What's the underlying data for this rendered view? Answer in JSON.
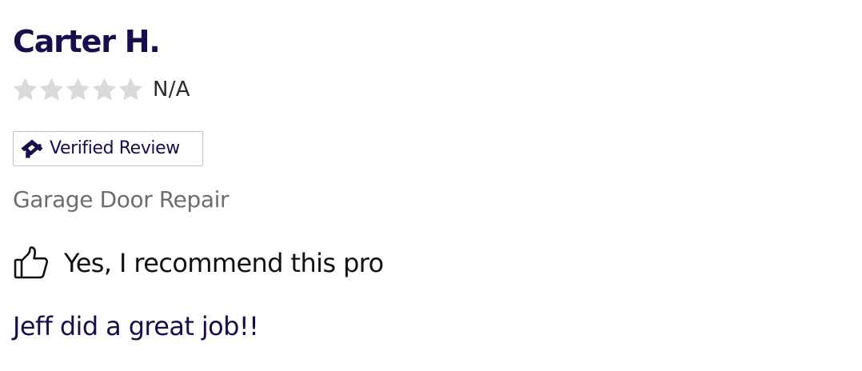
{
  "reviewer": {
    "name": "Carter H."
  },
  "rating": {
    "value_label": "N/A",
    "stars_filled": 0,
    "stars_total": 5,
    "star_icon": "star-icon",
    "empty_star_color": "#dadada"
  },
  "badge": {
    "label": "Verified Review",
    "icon": "house-check-icon"
  },
  "service": {
    "type": "Garage Door Repair"
  },
  "recommendation": {
    "icon": "thumbs-up-icon",
    "text": "Yes, I recommend this pro"
  },
  "review": {
    "text": "Jeff did a great job!!"
  },
  "colors": {
    "brand_navy": "#160f4b",
    "muted_text": "#6d6d6d",
    "badge_border": "#c4c4c4"
  }
}
